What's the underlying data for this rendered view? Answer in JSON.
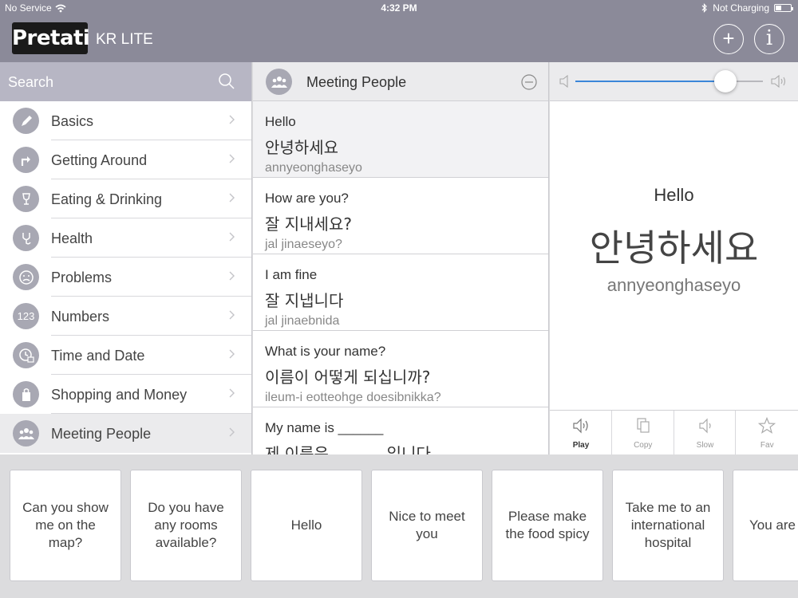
{
  "status_bar": {
    "carrier": "No Service",
    "time": "4:32 PM",
    "charging": "Not Charging"
  },
  "header": {
    "logo": "Pretati",
    "subtitle": "KR LITE",
    "add_label": "+",
    "info_label": "i"
  },
  "sidebar": {
    "search_placeholder": "Search",
    "items": [
      {
        "label": "Basics",
        "icon": "pen-icon"
      },
      {
        "label": "Getting Around",
        "icon": "turn-arrow-icon"
      },
      {
        "label": "Eating & Drinking",
        "icon": "glass-icon"
      },
      {
        "label": "Health",
        "icon": "stethoscope-icon"
      },
      {
        "label": "Problems",
        "icon": "sad-face-icon"
      },
      {
        "label": "Numbers",
        "icon": "numbers-icon"
      },
      {
        "label": "Time and Date",
        "icon": "clock-calendar-icon"
      },
      {
        "label": "Shopping and Money",
        "icon": "shopping-bag-icon"
      },
      {
        "label": "Meeting People",
        "icon": "people-icon"
      }
    ],
    "numbers_glyph": "123"
  },
  "phrase_list": {
    "title": "Meeting People",
    "phrases": [
      {
        "en": "Hello",
        "ko": "안녕하세요",
        "rom": "annyeonghaseyo"
      },
      {
        "en": "How are you?",
        "ko": "잘 지내세요?",
        "rom": "jal jinaeseyo?"
      },
      {
        "en": "I am fine",
        "ko": "잘 지냅니다",
        "rom": "jal jinaebnida"
      },
      {
        "en": "What is your name?",
        "ko": "이름이 어떻게 되십니까?",
        "rom": "ileum-i eotteohge doesibnikka?"
      },
      {
        "en": "My name is ______",
        "ko": "제 이름은 ______ 입니다",
        "rom": ""
      }
    ]
  },
  "detail": {
    "volume_level": 0.8,
    "en": "Hello",
    "ko": "안녕하세요",
    "rom": "annyeonghaseyo",
    "actions": [
      {
        "label": "Play",
        "icon": "speaker-icon"
      },
      {
        "label": "Copy",
        "icon": "copy-icon"
      },
      {
        "label": "Slow",
        "icon": "speaker-slow-icon"
      },
      {
        "label": "Fav",
        "icon": "star-icon"
      }
    ]
  },
  "quick_cards": [
    "Can you show me on the map?",
    "Do you have any rooms available?",
    "Hello",
    "Nice to meet you",
    "Please make the food spicy",
    "Take me to an international hospital",
    "You are beautiful"
  ],
  "colors": {
    "header_bg": "#8b8a99",
    "search_bg": "#b7b6c4",
    "icon_bg": "#a8a8b3",
    "slider_accent": "#3b86d9"
  }
}
